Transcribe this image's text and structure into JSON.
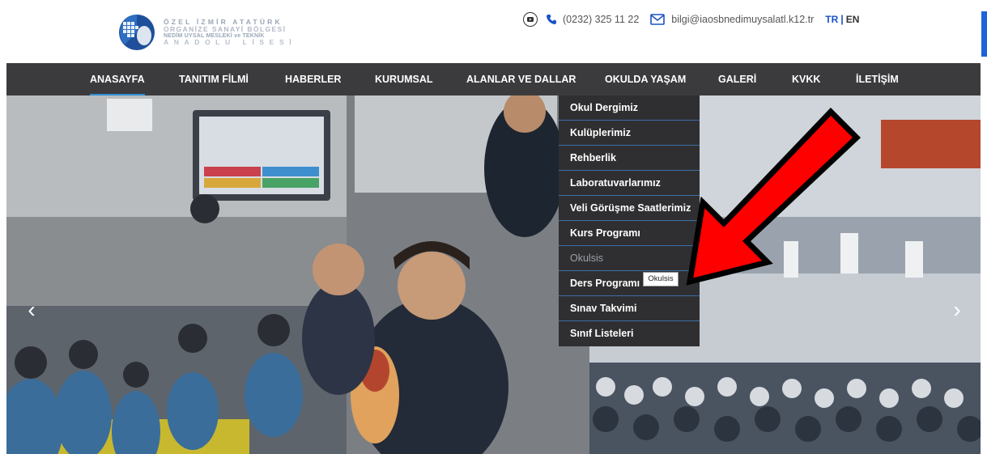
{
  "logo": {
    "line1": "ÖZEL İZMİR ATATÜRK",
    "line2": "ORGANİZE SANAYİ BÖLGESİ",
    "line3": "NEDİM UYSAL MESLEKİ ve TEKNİK",
    "line4": "ANADOLU LİSESİ"
  },
  "contact": {
    "youtube_icon": "youtube-icon",
    "phone_icon": "phone-icon",
    "phone": "(0232) 325 11 22",
    "mail_icon": "mail-icon",
    "email": "bilgi@iaosbnedimuysalatl.k12.tr",
    "lang_tr": "TR",
    "lang_separator": "|",
    "lang_en": "EN"
  },
  "nav": {
    "items": [
      {
        "label": "ANASAYFA",
        "active": true
      },
      {
        "label": "TANITIM FİLMİ"
      },
      {
        "label": "HABERLER"
      },
      {
        "label": "KURUMSAL"
      },
      {
        "label": "ALANLAR VE DALLAR"
      },
      {
        "label": "OKULDA YAŞAM"
      },
      {
        "label": "GALERİ"
      },
      {
        "label": "KVKK"
      },
      {
        "label": "İLETİŞİM"
      }
    ]
  },
  "dropdown": {
    "items": [
      "Okul Dergimiz",
      "Kulüplerimiz",
      "Rehberlik",
      "Laboratuvarlarımız",
      "Veli Görüşme Saatlerimiz",
      "Kurs Programı",
      "Okulsis",
      "Ders Programı",
      "Sınav Takvimi",
      "Sınıf Listeleri"
    ],
    "hovered": "Okulsis"
  },
  "tooltip": "Okulsis",
  "slider": {
    "prev_icon": "chevron-left-icon",
    "next_icon": "chevron-right-icon",
    "prev_glyph": "‹",
    "next_glyph": "›"
  },
  "colors": {
    "nav_bg": "#3b3b3d",
    "dropdown_bg": "#2f2f31",
    "accent_blue": "#1a52c9",
    "annotation_arrow": "#ff0000"
  }
}
